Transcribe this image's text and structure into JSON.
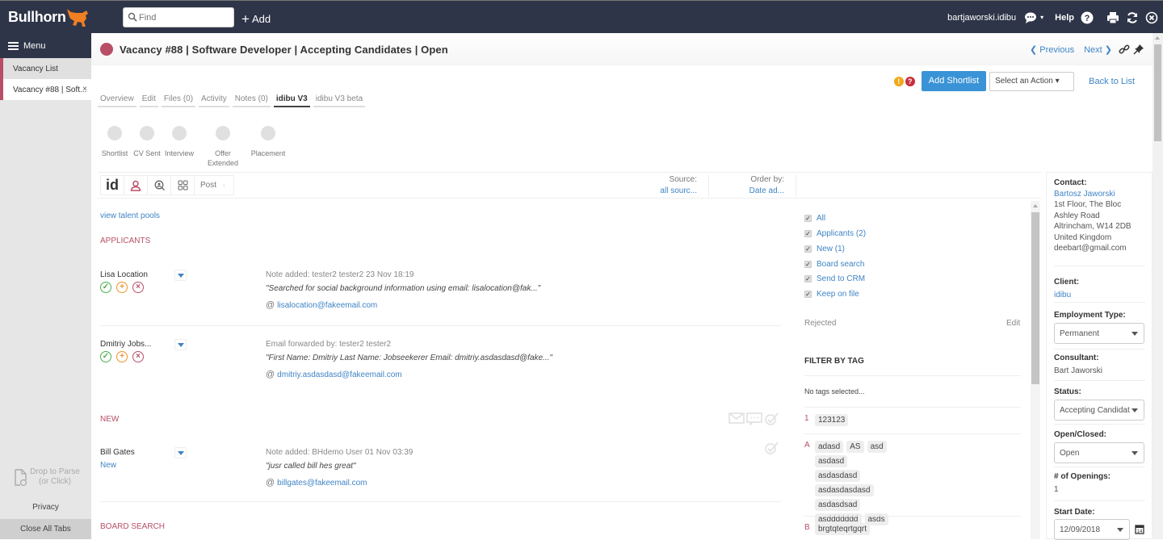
{
  "topbar": {
    "brand": "Bullhorn",
    "search_placeholder": "Find",
    "add_label": "Add",
    "username": "bartjaworski.idibu",
    "help_label": "Help"
  },
  "sidebar": {
    "menu_label": "Menu",
    "tabs": [
      {
        "label": "Vacancy List",
        "active": false
      },
      {
        "label": "Vacancy #88 | Soft...",
        "active": true,
        "close": "×"
      }
    ],
    "drop_line1": "Drop to Parse",
    "drop_line2": "(or Click)",
    "privacy": "Privacy",
    "close_all": "Close All Tabs"
  },
  "header": {
    "title": "Vacancy #88 | Software Developer | Accepting Candidates | Open",
    "status_color": "#b84f67",
    "previous": "Previous",
    "next": "Next"
  },
  "actions": {
    "add_shortlist": "Add Shortlist",
    "select_action": "Select an Action ▾",
    "back_to_list": "Back to List"
  },
  "tabs": [
    {
      "label": "Overview",
      "active": false
    },
    {
      "label": "Edit",
      "active": false
    },
    {
      "label": "Files (0)",
      "active": false
    },
    {
      "label": "Activity",
      "active": false
    },
    {
      "label": "Notes (0)",
      "active": false
    },
    {
      "label": "idibu V3",
      "active": true
    },
    {
      "label": "idibu V3 beta",
      "active": false
    }
  ],
  "pipeline": [
    {
      "label": "Shortlist"
    },
    {
      "label": "CV Sent"
    },
    {
      "label": "Interview"
    },
    {
      "label": "Offer Extended"
    },
    {
      "label": "Placement"
    }
  ],
  "toolbar": {
    "id_label": "id",
    "post_label": "Post",
    "source_label": "Source:",
    "source_value": "all sourc...",
    "order_label": "Order by:",
    "order_value": "Date ad..."
  },
  "list": {
    "talent_pools_link": "view talent pools",
    "sections": {
      "applicants": "APPLICANTS",
      "new": "NEW",
      "board_search": "BOARD SEARCH"
    },
    "candidates": [
      {
        "name": "Lisa Location",
        "note": "Note added: tester2 tester2 23 Nov 18:19",
        "quote": "\"Searched for social background information using email: lisalocation@fak...\"",
        "email": "lisalocation@fakeemail.com"
      },
      {
        "name": "Dmitriy Jobs...",
        "note": "Email forwarded by: tester2 tester2",
        "quote": "\"First Name: Dmitriy Last Name: Jobseekerer Email: dmitriy.asdasdasd@fake...\"",
        "email": "dmitriy.asdasdasd@fakeemail.com"
      },
      {
        "name": "Bill Gates",
        "status": "New",
        "note": "Note added: BHdemo User 01 Nov 03:39",
        "quote": "\"jusr called bill hes great\"",
        "email": "billgates@fakeemail.com"
      }
    ]
  },
  "filters": {
    "checkboxes": [
      {
        "label": "All",
        "checked": true
      },
      {
        "label": "Applicants (2)",
        "checked": true
      },
      {
        "label": "New (1)",
        "checked": true
      },
      {
        "label": "Board search",
        "checked": true
      },
      {
        "label": "Send to CRM",
        "checked": true
      },
      {
        "label": "Keep on file",
        "checked": true
      }
    ],
    "rejected_label": "Rejected",
    "edit_label": "Edit",
    "filter_by_tag": "FILTER BY TAG",
    "no_tags": "No tags selected...",
    "tag_groups": [
      {
        "letter": "1",
        "tags": [
          "123123"
        ]
      },
      {
        "letter": "A",
        "tags": [
          "adasd",
          "AS",
          "asd",
          "asdasd",
          "asdasdasd",
          "asdasdasdasd",
          "asdasdsad",
          "asddddddd",
          "asds"
        ]
      },
      {
        "letter": "B",
        "tags": [
          "brgtqteqrtgqrt"
        ]
      }
    ]
  },
  "details": {
    "contact_label": "Contact:",
    "contact_name": "Bartosz Jaworski",
    "address": [
      "1st Floor, The Bloc",
      "Ashley Road",
      "Altrincham, W14 2DB",
      "United Kingdom",
      "deebart@gmail.com"
    ],
    "client_label": "Client:",
    "client_value": "idibu",
    "employment_label": "Employment Type:",
    "employment_value": "Permanent",
    "consultant_label": "Consultant:",
    "consultant_value": "Bart Jaworski",
    "status_label": "Status:",
    "status_value": "Accepting Candidat",
    "open_label": "Open/Closed:",
    "open_value": "Open",
    "openings_label": "# of Openings:",
    "openings_value": "1",
    "start_label": "Start Date:",
    "start_value": "12/09/2018"
  },
  "colors": {
    "topbar": "#2e3548",
    "accent_blue": "#3f84c5",
    "brand_red": "#b84f67",
    "button_blue": "#3a93d6",
    "bull_orange": "#f07f22"
  }
}
